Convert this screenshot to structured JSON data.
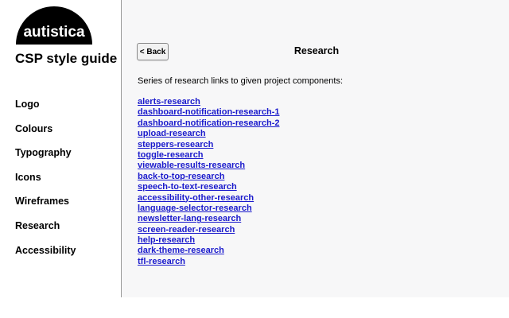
{
  "sidebar": {
    "logo_text": "autistica",
    "title": "CSP style guide",
    "nav": [
      "Logo",
      "Colours",
      "Typography",
      "Icons",
      "Wireframes",
      "Research",
      "Accessibility"
    ]
  },
  "main": {
    "back_label": "< Back",
    "title": "Research",
    "intro": "Series of research links to given project components:",
    "links": [
      "alerts-research",
      "dashboard-notification-research-1",
      "dashboard-notification-research-2",
      "upload-research",
      "steppers-research",
      "toggle-research",
      "viewable-results-research",
      "back-to-top-research",
      "speech-to-text-research",
      "accessibility-other-research",
      "language-selector-research",
      "newsletter-lang-research",
      "screen-reader-research",
      "help-research",
      "dark-theme-research",
      "tfl-research"
    ]
  },
  "colors": {
    "link": "#1a1acc",
    "main_background": "#f7f7f8",
    "logo_background": "#000000",
    "logo_text": "#ffffff"
  }
}
